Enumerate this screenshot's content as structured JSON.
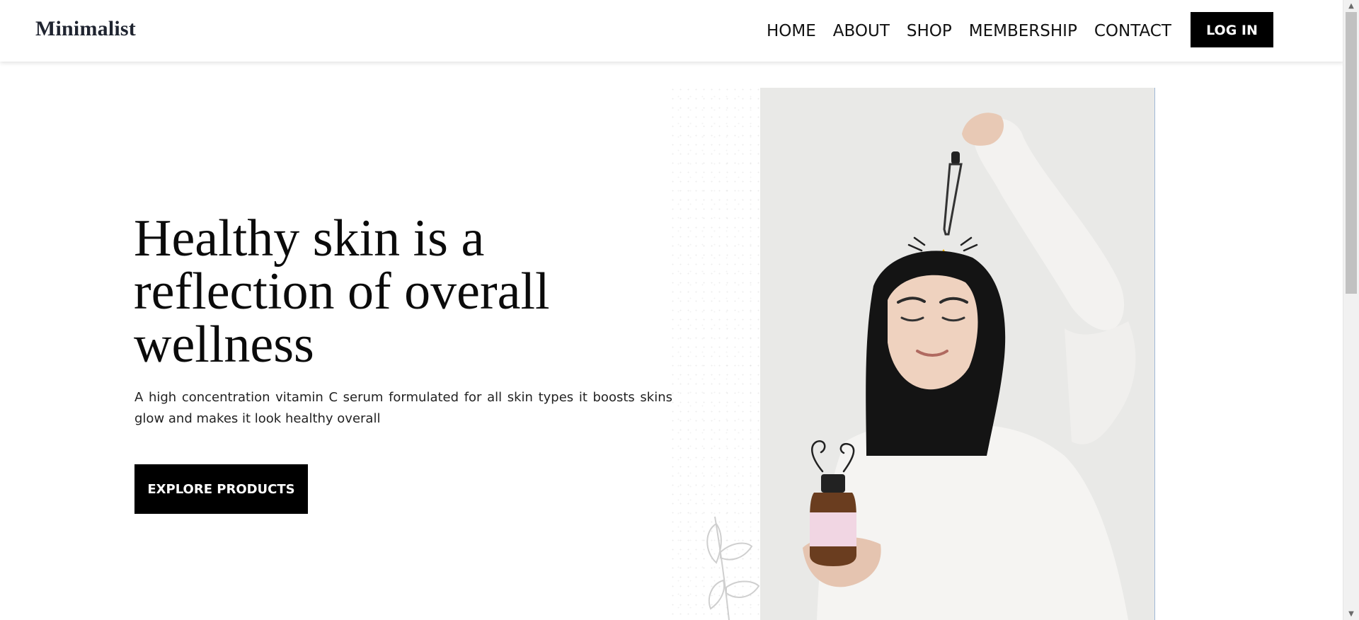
{
  "header": {
    "brand": "Minimalist",
    "nav": [
      "HOME",
      "ABOUT",
      "SHOP",
      "MEMBERSHIP",
      "CONTACT"
    ],
    "login_label": "LOG IN"
  },
  "hero": {
    "title": "Healthy skin is a reflection of overall wellness",
    "description": "A high concentration vitamin C serum formulated for all skin types it boosts skins glow and makes it look healthy overall",
    "cta_label": "EXPLORE PRODUCTS"
  },
  "colors": {
    "primary": "#000000",
    "background": "#ffffff",
    "text": "#111111",
    "accent_drop": "#f4b400"
  },
  "icons": {
    "scroll_up": "triangle-up-icon",
    "scroll_down": "triangle-down-icon"
  }
}
